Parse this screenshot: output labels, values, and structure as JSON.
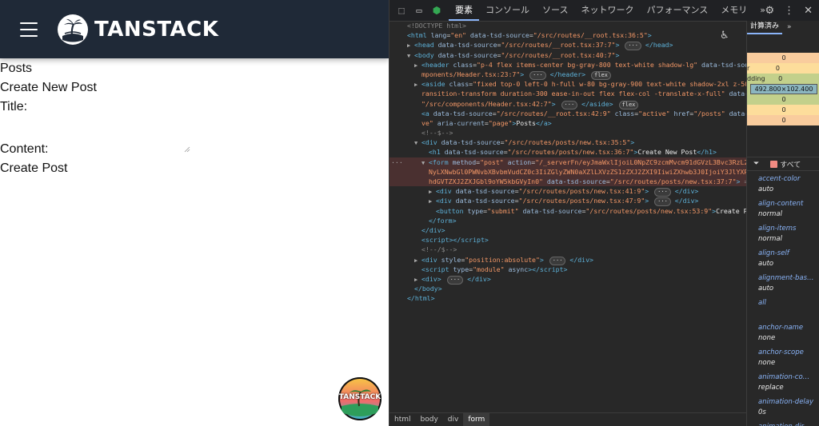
{
  "app": {
    "brand": "TANSTACK",
    "nav_link": "Posts",
    "heading": "Create New Post",
    "title_label": "Title:",
    "content_label": "Content:",
    "submit_label": "Create Post",
    "badge_text": "TANSTACK"
  },
  "devtools": {
    "tabs": [
      "要素",
      "コンソール",
      "ソース",
      "ネットワーク",
      "パフォーマンス",
      "メモリ"
    ],
    "active_tab": "要素",
    "more_tabs": "»",
    "side_tab": "計算済み",
    "filter_label": "すべて",
    "box_model": {
      "margin_value": "0",
      "border_label": "r",
      "border_value": "0",
      "padding_label": "dding",
      "padding_value": "0",
      "content_size": "492.800×102.400",
      "padding_bottom": "0",
      "border_bottom": "0",
      "margin_bottom": "0"
    },
    "computed_props": [
      {
        "name": "accent-color",
        "value": "auto"
      },
      {
        "name": "align-content",
        "value": "normal"
      },
      {
        "name": "align-items",
        "value": "normal"
      },
      {
        "name": "align-self",
        "value": "auto"
      },
      {
        "name": "alignment-bas…",
        "value": "auto"
      },
      {
        "name": "all",
        "value": ""
      },
      {
        "name": "anchor-name",
        "value": "none"
      },
      {
        "name": "anchor-scope",
        "value": "none"
      },
      {
        "name": "animation-co…",
        "value": "replace"
      },
      {
        "name": "animation-delay",
        "value": "0s"
      },
      {
        "name": "animation-dir…",
        "value": ""
      }
    ],
    "breadcrumbs": [
      "html",
      "body",
      "div",
      "form"
    ],
    "dom_lines": [
      {
        "indent": 1,
        "tri": "",
        "html": "<span class='cmt'>&lt;!DOCTYPE html&gt;</span>"
      },
      {
        "indent": 1,
        "tri": "",
        "html": "<span class='tag'>&lt;html</span> <span class='attr'>lang</span>=<span class='val'>\"en\"</span> <span class='attr'>data-tsd-source</span>=<span class='val'>\"/src/routes/__root.tsx:36:5\"</span><span class='tag'>&gt;</span>"
      },
      {
        "indent": 2,
        "tri": "▶",
        "html": "<span class='tag'>&lt;head</span> <span class='attr'>data-tsd-source</span>=<span class='val'>\"/src/routes/__root.tsx:37:7\"</span><span class='tag'>&gt;</span> <span class='pill'>···</span> <span class='tag'>&lt;/head&gt;</span>"
      },
      {
        "indent": 2,
        "tri": "▼",
        "html": "<span class='tag'>&lt;body</span> <span class='attr'>data-tsd-source</span>=<span class='val'>\"/src/routes/__root.tsx:40:7\"</span><span class='tag'>&gt;</span>"
      },
      {
        "indent": 3,
        "tri": "▶",
        "html": "<span class='tag'>&lt;header</span> <span class='attr'>class</span>=<span class='val'>\"p-4 flex items-center bg-gray-800 text-white shadow-lg\"</span> <span class='attr'>data-tsd-source</span>=<span class='val'>\"/src/co</span>"
      },
      {
        "indent": 3,
        "tri": "",
        "html": "<span class='val'>mponents/Header.tsx:23:7\"</span><span class='tag'>&gt;</span> <span class='pill'>···</span> <span class='tag'>&lt;/header&gt;</span> <span class='pill'>flex</span>"
      },
      {
        "indent": 3,
        "tri": "▶",
        "html": "<span class='tag'>&lt;aside</span> <span class='attr'>class</span>=<span class='val'>\"fixed top-0 left-0 h-full w-80 bg-gray-900 text-white shadow-2xl z-50 transform t</span>"
      },
      {
        "indent": 3,
        "tri": "",
        "html": "<span class='val'>ransition-transform duration-300 ease-in-out flex flex-col -translate-x-full\"</span> <span class='attr'>data-tsd-source</span>="
      },
      {
        "indent": 3,
        "tri": "",
        "html": "<span class='val'>\"/src/components/Header.tsx:42:7\"</span><span class='tag'>&gt;</span> <span class='pill'>···</span> <span class='tag'>&lt;/aside&gt;</span> <span class='pill'>flex</span>"
      },
      {
        "indent": 3,
        "tri": "",
        "html": "<span class='tag'>&lt;a</span> <span class='attr'>data-tsd-source</span>=<span class='val'>\"/src/routes/__root.tsx:42:9\"</span> <span class='attr'>class</span>=<span class='val'>\"active\"</span> <span class='attr'>href</span>=<span class='val'>\"/posts\"</span> <span class='attr'>data-status</span>=<span class='val'>\"acti</span>"
      },
      {
        "indent": 3,
        "tri": "",
        "html": "<span class='val'>ve\"</span> <span class='attr'>aria-current</span>=<span class='val'>\"page\"</span><span class='tag'>&gt;</span><span class='txt'>Posts</span><span class='tag'>&lt;/a&gt;</span>"
      },
      {
        "indent": 3,
        "tri": "",
        "html": "<span class='cmt'>&lt;!--$--&gt;</span>"
      },
      {
        "indent": 3,
        "tri": "▼",
        "html": "<span class='tag'>&lt;div</span> <span class='attr'>data-tsd-source</span>=<span class='val'>\"/src/routes/posts/new.tsx:35:5\"</span><span class='tag'>&gt;</span>"
      },
      {
        "indent": 4,
        "tri": "",
        "html": "<span class='tag'>&lt;h1</span> <span class='attr'>data-tsd-source</span>=<span class='val'>\"/src/routes/posts/new.tsx:36:7\"</span><span class='tag'>&gt;</span><span class='txt'>Create New Post</span><span class='tag'>&lt;/h1&gt;</span>"
      },
      {
        "indent": 4,
        "tri": "▼",
        "sel": true,
        "html": "<span class='tag'>&lt;form</span> <span class='attr'>method</span>=<span class='val'>\"post\"</span> <span class='attr'>action</span>=<span class='val'>\"/_serverFn/eyJmaWxlIjoiL0NpZC9zcmMvcm91dGVzL3Bvc3RzL25ldy50c3g_dH</span>"
      },
      {
        "indent": 4,
        "tri": "",
        "sel": true,
        "html": "<span class='val'>NyLXNwbGl0PWNvbXBvbmVudCZ0c3IiZGlyZWN0aXZlLXVzZS1zZXJ2ZXI9IiwiZXhwb3J0IjoiY3JlYXRlUG9zdF9jcmV</span>"
      },
      {
        "indent": 4,
        "tri": "",
        "sel": true,
        "html": "<span class='val'>hdGVTZXJ2ZXJGbl9oYW5kbGVyIn0\"</span> <span class='attr'>data-tsd-source</span>=<span class='val'>\"/src/routes/posts/new.tsx:37:7\"</span><span class='tag'>&gt;</span> <span class='cmt'>== $0</span>"
      },
      {
        "indent": 5,
        "tri": "▶",
        "html": "<span class='tag'>&lt;div</span> <span class='attr'>data-tsd-source</span>=<span class='val'>\"/src/routes/posts/new.tsx:41:9\"</span><span class='tag'>&gt;</span> <span class='pill'>···</span> <span class='tag'>&lt;/div&gt;</span>"
      },
      {
        "indent": 5,
        "tri": "▶",
        "html": "<span class='tag'>&lt;div</span> <span class='attr'>data-tsd-source</span>=<span class='val'>\"/src/routes/posts/new.tsx:47:9\"</span><span class='tag'>&gt;</span> <span class='pill'>···</span> <span class='tag'>&lt;/div&gt;</span>"
      },
      {
        "indent": 5,
        "tri": "",
        "html": "<span class='tag'>&lt;button</span> <span class='attr'>type</span>=<span class='val'>\"submit\"</span> <span class='attr'>data-tsd-source</span>=<span class='val'>\"/src/routes/posts/new.tsx:53:9\"</span><span class='tag'>&gt;</span><span class='txt'>Create Post</span><span class='tag'>&lt;/button&gt;</span>"
      },
      {
        "indent": 4,
        "tri": "",
        "html": "<span class='tag'>&lt;/form&gt;</span>"
      },
      {
        "indent": 3,
        "tri": "",
        "html": "<span class='tag'>&lt;/div&gt;</span>"
      },
      {
        "indent": 3,
        "tri": "",
        "html": "<span class='tag'>&lt;script&gt;&lt;/script&gt;</span>"
      },
      {
        "indent": 3,
        "tri": "",
        "html": "<span class='cmt'>&lt;!--/$--&gt;</span>"
      },
      {
        "indent": 3,
        "tri": "▶",
        "html": "<span class='tag'>&lt;div</span> <span class='attr'>style</span>=<span class='val'>\"position:absolute\"</span><span class='tag'>&gt;</span> <span class='pill'>···</span> <span class='tag'>&lt;/div&gt;</span>"
      },
      {
        "indent": 3,
        "tri": "",
        "html": "<span class='tag'>&lt;script</span> <span class='attr'>type</span>=<span class='val'>\"module\"</span> <span class='attr'>async</span><span class='tag'>&gt;&lt;/script&gt;</span>"
      },
      {
        "indent": 3,
        "tri": "▶",
        "html": "<span class='tag'>&lt;div&gt;</span> <span class='pill'>···</span> <span class='tag'>&lt;/div&gt;</span>"
      },
      {
        "indent": 2,
        "tri": "",
        "html": "<span class='tag'>&lt;/body&gt;</span>"
      },
      {
        "indent": 1,
        "tri": "",
        "html": "<span class='tag'>&lt;/html&gt;</span>"
      }
    ]
  }
}
